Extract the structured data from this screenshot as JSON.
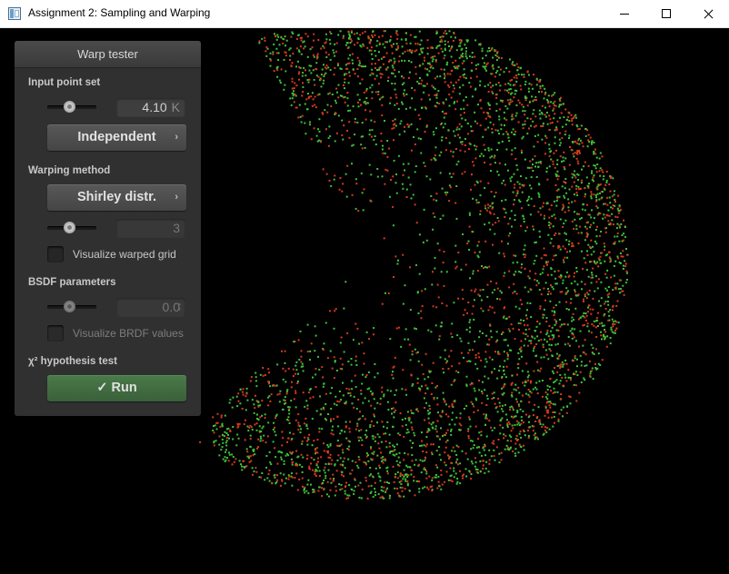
{
  "window": {
    "title": "Assignment 2: Sampling and Warping",
    "icon": "app-window-icon"
  },
  "panel": {
    "title": "Warp tester",
    "input_point_set": {
      "label": "Input point set",
      "slider_value": 0.45,
      "count_value": "4.10",
      "count_unit": "K",
      "point_type": "Independent"
    },
    "warping_method": {
      "label": "Warping method",
      "method": "Shirley distr.",
      "slider_value": 0.45,
      "parameter_value": "3",
      "visualize_grid_label": "Visualize warped grid",
      "visualize_grid_checked": false
    },
    "bsdf": {
      "label": "BSDF parameters",
      "slider_value": 0.45,
      "value": "0.0",
      "visualize_brdf_label": "Visualize BRDF values",
      "visualize_brdf_checked": false
    },
    "hypothesis_test": {
      "label": "χ² hypothesis test",
      "run_label": "Run",
      "run_icon": "check-icon",
      "run_glyph": "✓"
    }
  },
  "visualization": {
    "point_count": 4100,
    "colors": {
      "green": "#3fc23a",
      "red": "#d63a1e",
      "background": "#000000"
    }
  }
}
